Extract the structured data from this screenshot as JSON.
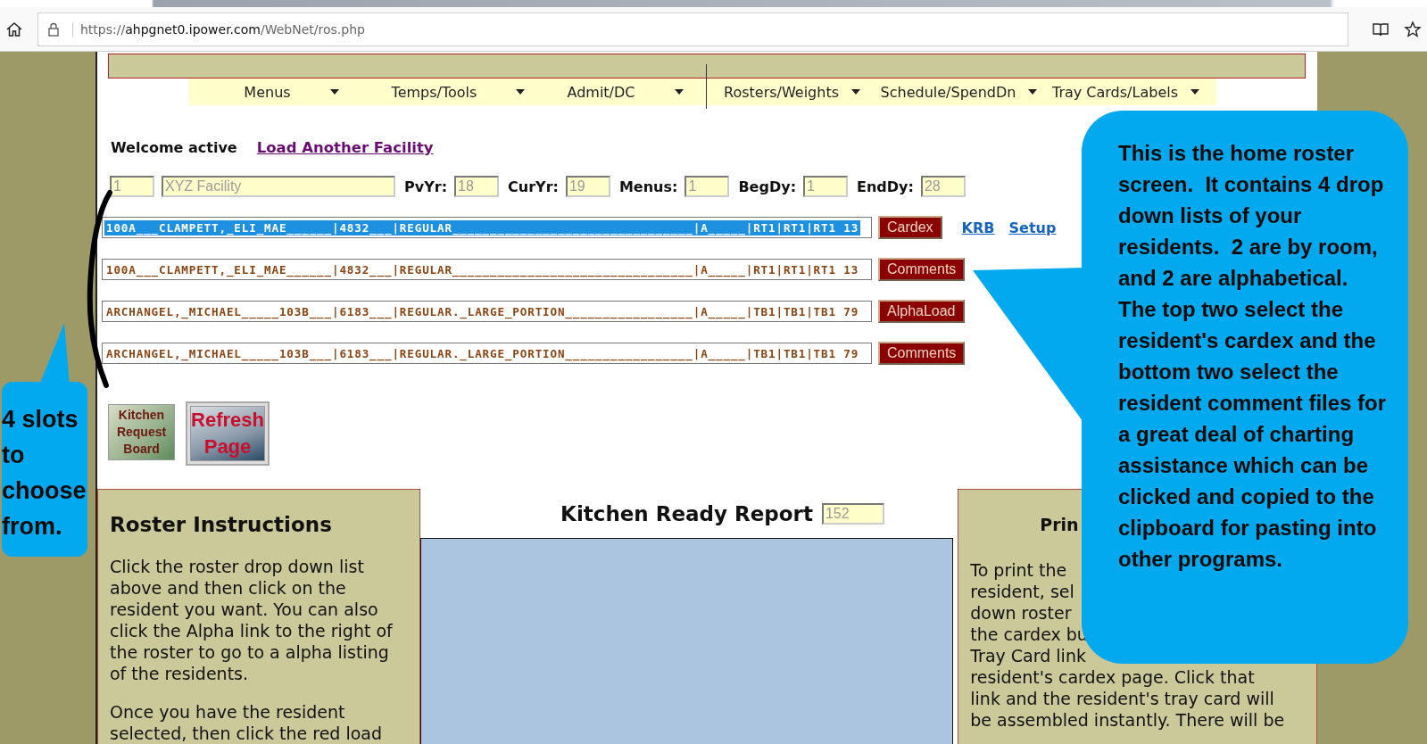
{
  "browser": {
    "url": {
      "scheme": "https://",
      "host": "ahpgnet0.ipower.com",
      "path": "/WebNet/ros.php"
    }
  },
  "nav": [
    {
      "label": "Menus"
    },
    {
      "label": "Temps/Tools"
    },
    {
      "label": "Admit/DC"
    },
    {
      "label": "Rosters/Weights"
    },
    {
      "label": "Schedule/SpendDn"
    },
    {
      "label": "Tray Cards/Labels"
    }
  ],
  "welcome": {
    "text": "Welcome active",
    "link": "Load Another Facility"
  },
  "facility_fields": [
    {
      "value": "1",
      "kind": "short",
      "disabled": true
    },
    {
      "value": "XYZ Facility",
      "kind": "wide",
      "disabled": true
    },
    {
      "label": "PvYr:",
      "value": "18",
      "kind": "short",
      "disabled": true
    },
    {
      "label": "CurYr:",
      "value": "19",
      "kind": "short",
      "disabled": true
    },
    {
      "label": "Menus:",
      "value": "1",
      "kind": "short",
      "disabled": true
    },
    {
      "label": "BegDy:",
      "value": "1",
      "kind": "short",
      "disabled": true
    },
    {
      "label": "EndDy:",
      "value": "28",
      "kind": "short",
      "disabled": true
    }
  ],
  "rosters": [
    {
      "value": "100A___CLAMPETT,_ELI_MAE______|4832___|REGULAR________________________________|A_____|RT1|RT1|RT1 13",
      "focused": true,
      "button": "Cardex"
    },
    {
      "value": "100A___CLAMPETT,_ELI_MAE______|4832___|REGULAR________________________________|A_____|RT1|RT1|RT1 13",
      "focused": false,
      "button": "Comments"
    },
    {
      "value": "ARCHANGEL,_MICHAEL_____103B___|6183___|REGULAR._LARGE_PORTION_________________|A_____|TB1|TB1|TB1 79",
      "focused": false,
      "button": "AlphaLoad"
    },
    {
      "value": "ARCHANGEL,_MICHAEL_____103B___|6183___|REGULAR._LARGE_PORTION_________________|A_____|TB1|TB1|TB1 79",
      "focused": false,
      "button": "Comments"
    }
  ],
  "links": [
    "KRB",
    "Setup"
  ],
  "image_buttons": [
    {
      "kind": "kitchen",
      "text": "Kitchen Request Board"
    },
    {
      "kind": "refresh",
      "text": "Refresh Page"
    }
  ],
  "roster_instructions": {
    "title": "Roster Instructions",
    "paragraphs": [
      "Click the roster drop down list above and then click on the resident you want. You can also click the Alpha link to the right of the roster to go to a alpha listing of the residents.",
      "Once you have the resident selected, then click the red load"
    ]
  },
  "kitchen_report": {
    "title": "Kitchen Ready Report",
    "count": "152",
    "disabled": true
  },
  "print_panel": {
    "title": "Prin",
    "lines": [
      "To print the",
      "resident, sel",
      "down roster",
      "the cardex bu",
      "Tray Card link",
      "resident's cardex page. Click that",
      "link and the resident's tray card will",
      "be assembled instantly. There will be"
    ]
  },
  "callouts": [
    {
      "kind": "right",
      "text": "This is the home roster screen.  It contains 4 drop down lists of your residents.  2 are by room, and 2 are alphabetical.  The top two select the resident's cardex and the bottom two select the resident comment files for a great deal of charting assistance which can be clicked and copied to the clipboard for pasting into other programs."
    },
    {
      "kind": "left",
      "text": "4 slots to choose from."
    }
  ]
}
